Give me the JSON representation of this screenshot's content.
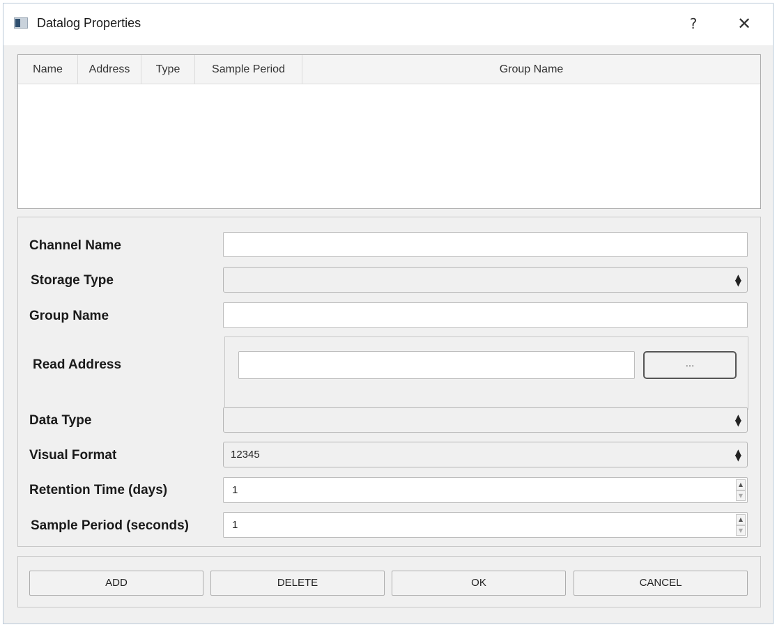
{
  "window": {
    "title": "Datalog Properties",
    "help_label": "?",
    "close_label": "✕"
  },
  "table": {
    "columns": [
      "Name",
      "Address",
      "Type",
      "Sample Period",
      "Group Name"
    ],
    "rows": []
  },
  "form": {
    "channel_name": {
      "label": "Channel Name",
      "value": ""
    },
    "storage_type": {
      "label": "Storage Type",
      "value": ""
    },
    "group_name": {
      "label": "Group Name",
      "value": ""
    },
    "read_address": {
      "label": "Read Address",
      "value": "",
      "browse_label": "..."
    },
    "data_type": {
      "label": "Data Type",
      "value": ""
    },
    "visual_format": {
      "label": "Visual Format",
      "value": "12345"
    },
    "retention_time": {
      "label": "Retention Time (days)",
      "value": "1"
    },
    "sample_period": {
      "label": "Sample Period (seconds)",
      "value": "1"
    }
  },
  "buttons": {
    "add": "ADD",
    "delete": "DELETE",
    "ok": "OK",
    "cancel": "CANCEL"
  },
  "icons": {
    "app": "window-icon",
    "combo_arrows": "up-down-arrows-icon",
    "spin_up": "spin-up-icon",
    "spin_down": "spin-down-icon"
  }
}
